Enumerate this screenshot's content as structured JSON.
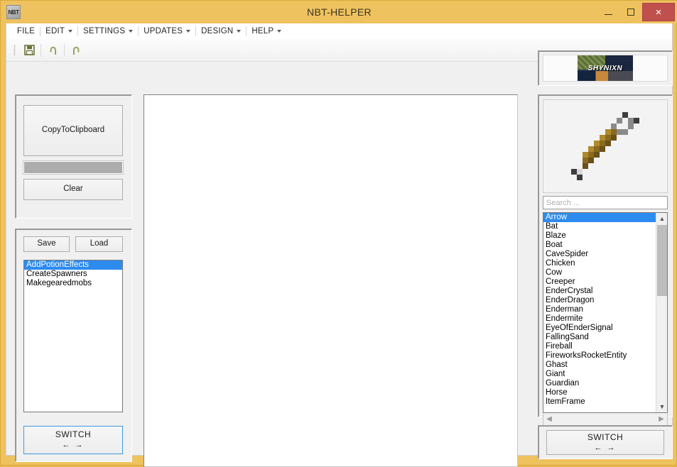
{
  "window": {
    "title": "NBT-HELPER",
    "app_icon_label": "NBT",
    "controls": {
      "minimize": "minimize-icon",
      "maximize": "maximize-icon",
      "close": "×"
    },
    "frame_color": "#eec25f",
    "close_color": "#c0504d"
  },
  "menu": {
    "items": [
      {
        "label": "FILE",
        "has_caret": false
      },
      {
        "label": "EDIT",
        "has_caret": true
      },
      {
        "label": "SETTINGS",
        "has_caret": true
      },
      {
        "label": "UPDATES",
        "has_caret": true
      },
      {
        "label": "DESIGN",
        "has_caret": true
      },
      {
        "label": "HELP",
        "has_caret": true
      }
    ]
  },
  "toolbar": {
    "buttons": [
      {
        "name": "save-icon",
        "tip": "Save"
      },
      {
        "name": "undo-icon",
        "tip": "Undo"
      },
      {
        "name": "redo-icon",
        "tip": "Redo"
      }
    ]
  },
  "left_panel": {
    "copy_button": "CopyToClipboard",
    "progress_value": "",
    "clear_button": "Clear"
  },
  "presets_panel": {
    "save_button": "Save",
    "load_button": "Load",
    "items": [
      "AddPotionEffects",
      "CreateSpawners",
      "Makegearedmobs"
    ],
    "selected_index": 0,
    "switch_label": "SWITCH",
    "switch_arrows": "← →"
  },
  "editor": {
    "content": ""
  },
  "right_panel": {
    "banner_text": "SHYNIXN",
    "preview_item": "arrow-item-icon",
    "search_placeholder": "Search ...",
    "search_value": "",
    "entities": [
      "Arrow",
      "Bat",
      "Blaze",
      "Boat",
      "CaveSpider",
      "Chicken",
      "Cow",
      "Creeper",
      "EnderCrystal",
      "EnderDragon",
      "Enderman",
      "Endermite",
      "EyeOfEnderSignal",
      "FallingSand",
      "Fireball",
      "FireworksRocketEntity",
      "Ghast",
      "Giant",
      "Guardian",
      "Horse",
      "ItemFrame"
    ],
    "selected_entity_index": 0,
    "switch_label": "SWITCH",
    "switch_arrows": "← →"
  },
  "colors": {
    "selection_blue": "#2d8bf0",
    "title_gold": "#eec25f",
    "focus_blue": "#3c99e0"
  }
}
